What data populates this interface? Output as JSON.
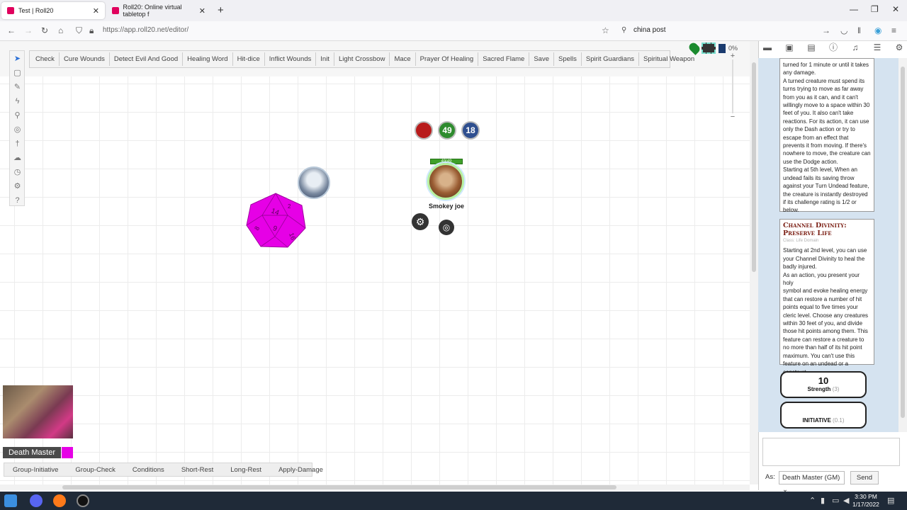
{
  "browser": {
    "tabs": [
      {
        "title": "Test | Roll20",
        "close": "✕"
      },
      {
        "title": "Roll20: Online virtual tabletop f",
        "close": "✕"
      }
    ],
    "new_tab": "+",
    "url": "https://app.roll20.net/editor/",
    "search_query": "china post",
    "window_controls": {
      "minimize": "—",
      "restore": "❐",
      "close": "✕"
    }
  },
  "macros": [
    "Check",
    "Cure Wounds",
    "Detect Evil And Good",
    "Healing Word",
    "Hit-dice",
    "Inflict Wounds",
    "Init",
    "Light Crossbow",
    "Mace",
    "Prayer Of Healing",
    "Sacred Flame",
    "Save",
    "Spells",
    "Spirit Guardians",
    "Spiritual Weapon"
  ],
  "zoom": {
    "percent": "0%"
  },
  "token": {
    "name": "Smokey joe",
    "hp_bar": "49/49",
    "bubbles": {
      "bar1": "",
      "bar2": "49",
      "bar3": "18"
    },
    "colors": {
      "bar1": "#b81b1b",
      "bar2": "#2e8b2e",
      "bar3": "#2f4f8f"
    }
  },
  "d20": {
    "faces": [
      "14",
      "6",
      "16",
      "8",
      "2"
    ],
    "color": "#e600e6"
  },
  "player": {
    "name": "Death Master",
    "color": "#e600e6"
  },
  "bottom_macros": [
    "Group-Initiative",
    "Group-Check",
    "Conditions",
    "Short-Rest",
    "Long-Rest",
    "Apply-Damage"
  ],
  "chat": {
    "turn_undead_text": [
      "turned for 1 minute or until it takes",
      "any damage.",
      "A turned creature must spend its",
      "turns trying to move as far away",
      "from you as it can, and it can't",
      "willingly move to a space within 30",
      "feet of you. It also can't take",
      "reactions. For its action, it can use",
      "only the Dash action or try to",
      "escape from an effect that",
      "prevents it from moving. If there's",
      "nowhere to move, the creature can",
      "use the Dodge action.",
      "Starting at 5th level, When an",
      "undead fails its saving throw",
      "against your Turn Undead feature,",
      "the creature is instantly destroyed",
      "if its challenge rating is 1/2 or",
      "below."
    ],
    "channel_divinity": {
      "title_line1": "Channel Divinity:",
      "title_line2": "Preserve Life",
      "subtitle": "Class: Life Domain",
      "body": [
        "Starting at 2nd level, you can use",
        "your Channel Divinity to heal the",
        "badly injured.",
        "As an action, you present your holy",
        "symbol and evoke healing energy",
        "that can restore a number of hit",
        "points equal to five times your",
        "cleric level. Choose any creatures",
        "within 30 feet of you, and divide",
        "those hit points among them. This",
        "feature can restore a creature to",
        "no more than half of its hit point",
        "maximum. You can't use this",
        "feature on an undead or a",
        "construct."
      ]
    },
    "strength_roll": {
      "value": "10",
      "label": "Strength",
      "detail": "(3)"
    },
    "initiative_roll": {
      "value": "",
      "label": "INITIATIVE",
      "detail": "(0.1)"
    },
    "as_label": "As:",
    "as_value": "Death Master (GM)",
    "send_label": "Send"
  },
  "taskbar": {
    "time": "3:30 PM",
    "date": "1/17/2022"
  }
}
